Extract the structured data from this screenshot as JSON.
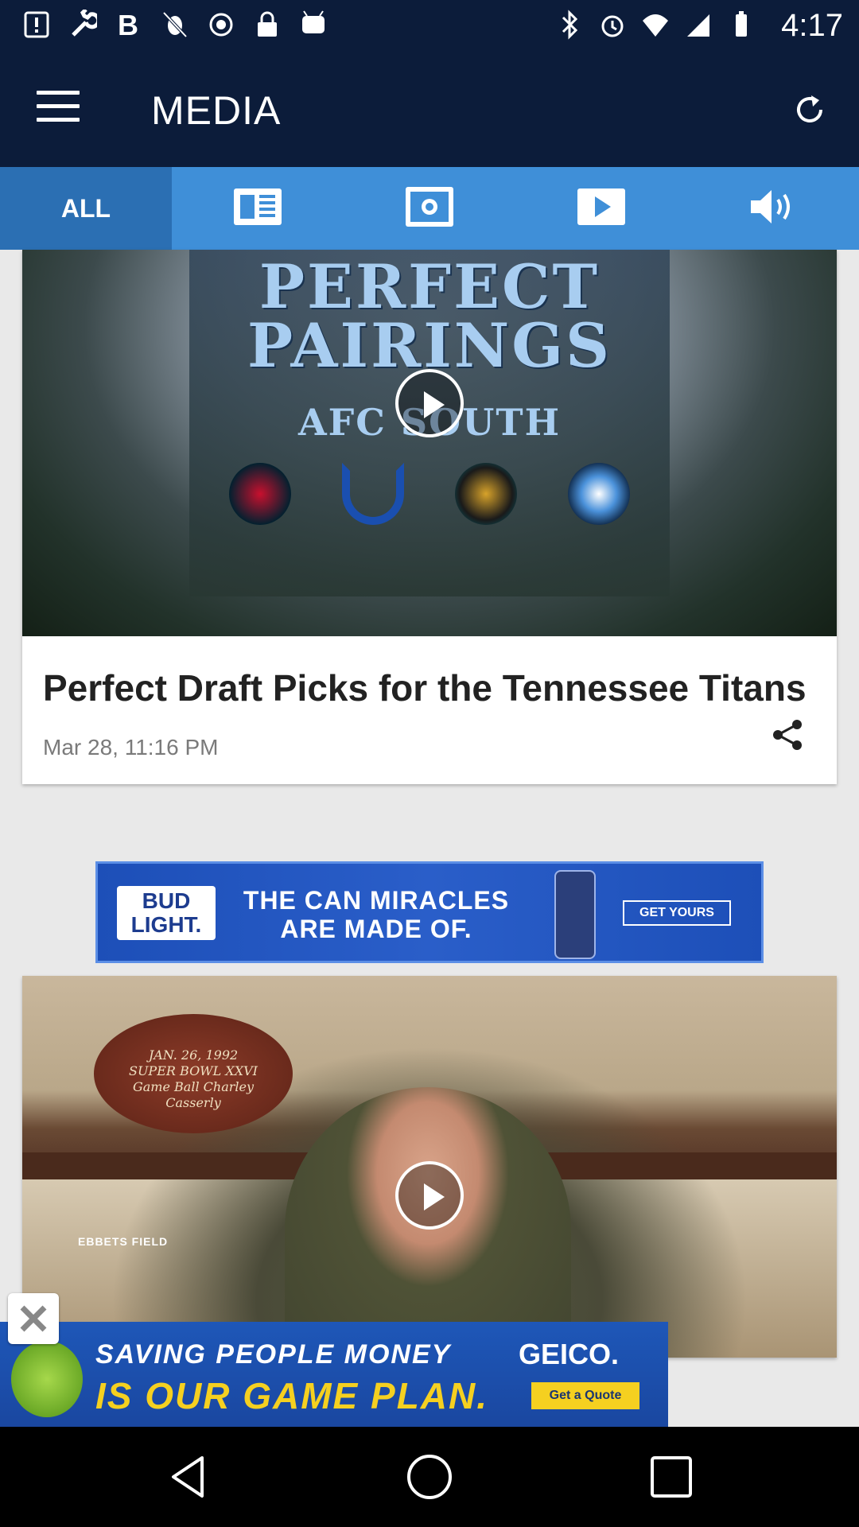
{
  "status_bar": {
    "time": "4:17",
    "left_icons": [
      "menu-alert-icon",
      "wrench-icon",
      "bold-b-icon",
      "no-bug-icon",
      "cast-icon",
      "lock-icon",
      "android-icon"
    ],
    "right_icons": [
      "bluetooth-icon",
      "alarm-icon",
      "wifi-icon",
      "signal-icon",
      "battery-icon"
    ]
  },
  "app_bar": {
    "title": "MEDIA",
    "menu_icon": "hamburger-menu-icon",
    "refresh_icon": "refresh-icon"
  },
  "tabs": [
    {
      "label": "ALL",
      "icon": "",
      "active": true
    },
    {
      "label": "",
      "icon": "article-icon",
      "active": false
    },
    {
      "label": "",
      "icon": "photo-icon",
      "active": false
    },
    {
      "label": "",
      "icon": "video-icon",
      "active": false
    },
    {
      "label": "",
      "icon": "audio-icon",
      "active": false
    }
  ],
  "feed": {
    "item1": {
      "image_text": {
        "headline": "PERFECT PAIRINGS",
        "sub": "AFC SOUTH"
      },
      "title": "Perfect Draft Picks for the Tennessee Titans",
      "date": "Mar 28, 11:16 PM"
    },
    "ad1": {
      "brand": "BUD LIGHT.",
      "text": "THE CAN MIRACLES ARE MADE OF.",
      "cta": "GET YOURS"
    },
    "item2": {
      "image_text": {
        "ball": "JAN. 26, 1992 SUPER BOWL XXVI Game Ball Charley Casserly",
        "sign": "EBBETS FIELD"
      }
    }
  },
  "bottom_ad": {
    "line1": "SAVING PEOPLE MONEY",
    "line2": "IS OUR GAME PLAN.",
    "brand": "GEICO.",
    "cta": "Get a Quote"
  },
  "colors": {
    "app_bar": "#0c1c3a",
    "tab_bar": "#3f8fd8",
    "tab_active": "#2b6fb3"
  }
}
